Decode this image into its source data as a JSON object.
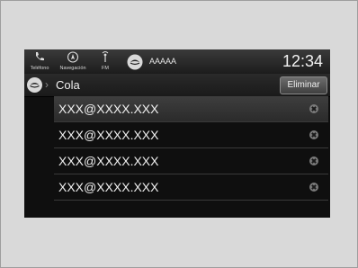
{
  "status_bar": {
    "phone_label": "Teléfono",
    "nav_label": "Navegación",
    "fm_label": "FM",
    "source_name": "AAAAA",
    "clock": "12:34"
  },
  "nav": {
    "title": "Cola",
    "delete_label": "Eliminar"
  },
  "queue": [
    {
      "text": "XXX@XXXX.XXX",
      "selected": true
    },
    {
      "text": "XXX@XXXX.XXX",
      "selected": false
    },
    {
      "text": "XXX@XXXX.XXX",
      "selected": false
    },
    {
      "text": "XXX@XXXX.XXX",
      "selected": false
    }
  ]
}
